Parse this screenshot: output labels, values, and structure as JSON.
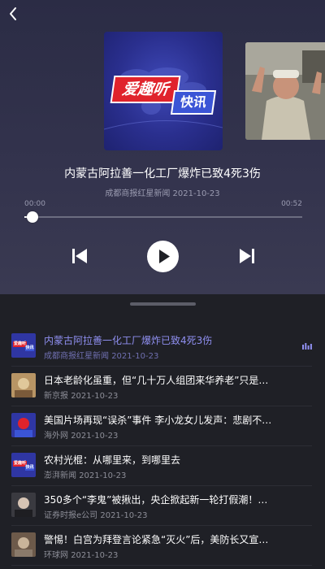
{
  "now_playing": {
    "cover_brand_red": "爱趣听",
    "cover_brand_blue": "快讯",
    "title": "内蒙古阿拉善一化工厂爆炸已致4死3伤",
    "source_date": "成都商报红星新闻 2021-10-23",
    "time_current": "00:00",
    "time_total": "00:52",
    "progress": 0.03
  },
  "icons": {
    "back": "chevron-left-icon",
    "prev": "skip-previous-icon",
    "play": "play-icon",
    "next": "skip-next-icon",
    "playing_indicator": "equalizer-icon"
  },
  "colors": {
    "accent_active": "#8f8ff0",
    "player_bg": "#33334d",
    "list_bg": "#1f2026"
  },
  "playlist": [
    {
      "title": "内蒙古阿拉善一化工厂爆炸已致4死3伤",
      "source": "成都商报红星新闻",
      "date": "2021-10-23",
      "active": true,
      "thumb": "brand-logo"
    },
    {
      "title": "日本老龄化虽重，但“几十万人组团来华养老”只是…",
      "source": "新京报",
      "date": "2021-10-23",
      "active": false,
      "thumb": "photo"
    },
    {
      "title": "美国片场再现“误杀”事件 李小龙女儿发声：悲剧不…",
      "source": "海外网",
      "date": "2021-10-23",
      "active": false,
      "thumb": "photo"
    },
    {
      "title": "农村光棍：从哪里来，到哪里去",
      "source": "澎湃新闻",
      "date": "2021-10-23",
      "active": false,
      "thumb": "brand-logo"
    },
    {
      "title": "350多个“李鬼”被揪出，央企掀起新一轮打假潮！…",
      "source": "证券时报e公司",
      "date": "2021-10-23",
      "active": false,
      "thumb": "photo"
    },
    {
      "title": "警惕！白宫为拜登言论紧急“灭火”后，美防长又宣…",
      "source": "环球网",
      "date": "2021-10-23",
      "active": false,
      "thumb": "photo"
    }
  ]
}
